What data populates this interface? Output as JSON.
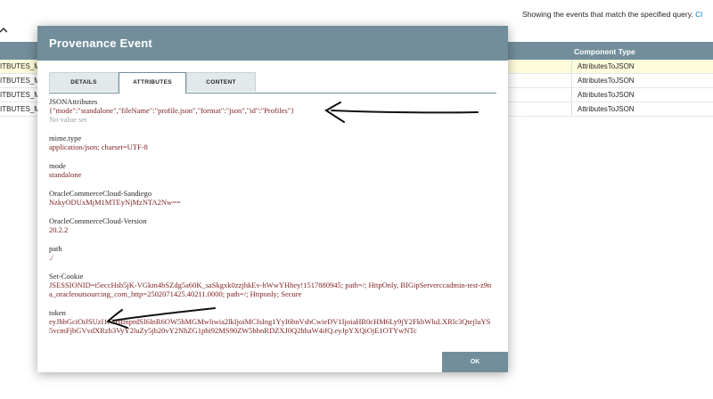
{
  "background": {
    "query_text": "Showing the events that match the specified query.",
    "query_link": "Cl",
    "table": {
      "component_type_header": "Component Type",
      "rows": [
        {
          "name": "ITBUTES_MC",
          "type": "AttributesToJSON"
        },
        {
          "name": "ITBUTES_MC",
          "type": "AttributesToJSON"
        },
        {
          "name": "ITBUTES_MC",
          "type": "AttributesToJSON"
        },
        {
          "name": "ITBUTES_MC",
          "type": "AttributesToJSON"
        }
      ]
    }
  },
  "dialog": {
    "title": "Provenance Event",
    "tabs": [
      {
        "label": "DETAILS",
        "active": false
      },
      {
        "label": "ATTRIBUTES",
        "active": true
      },
      {
        "label": "CONTENT",
        "active": false
      }
    ],
    "attributes": [
      {
        "name": "JSONAttributes",
        "value": "{\"mode\":\"standalone\",\"fileName\":\"profile.json\",\"format\":\"json\",\"id\":\"Profiles\"}",
        "note": "No value set"
      },
      {
        "name": "mime.type",
        "value": "application/json; charset=UTF-8"
      },
      {
        "name": "mode",
        "value": "standalone"
      },
      {
        "name": "OracleCommerceCloud-Sandiego",
        "value": "NzkyODUxMjM1MTEyNjMzNTA2Nw=="
      },
      {
        "name": "OracleCommerceCloud-Version",
        "value": "20.2.2"
      },
      {
        "name": "path",
        "value": "./"
      },
      {
        "name": "Set-Cookie",
        "value": "JSESSIONID=t5eccHsb5jK-VGkm4bSZdg5a60K_saSkgxk0zzjhkEv-hWwYHhey!1517880945; path=/; HttpOnly, BIGipServerccadmin-test-z9na_oracleoutsourcing_com_http=2502071425.40211.0000; path=/; Httponly; Secure"
      },
      {
        "name": "token",
        "value": "eyJhbGciOiJSUzI1NiIsImprdSI6InR6OW5hMGMwliwia2lkIjoiMCIsIng1YyI6bnVsbCwieDV1IjoiaHR0cHM6Ly9jY2FkbWluLXRlc3QtejluYS5vcmFjbGVvdXRzb3VyY2luZy5jb20vY2NhZG1pbi92MS90ZW5hbnRDZXJ0Q2hhaW4ifQ.eyJpYXQiOjE1OTYwNTc"
      }
    ],
    "ok_label": "OK"
  }
}
